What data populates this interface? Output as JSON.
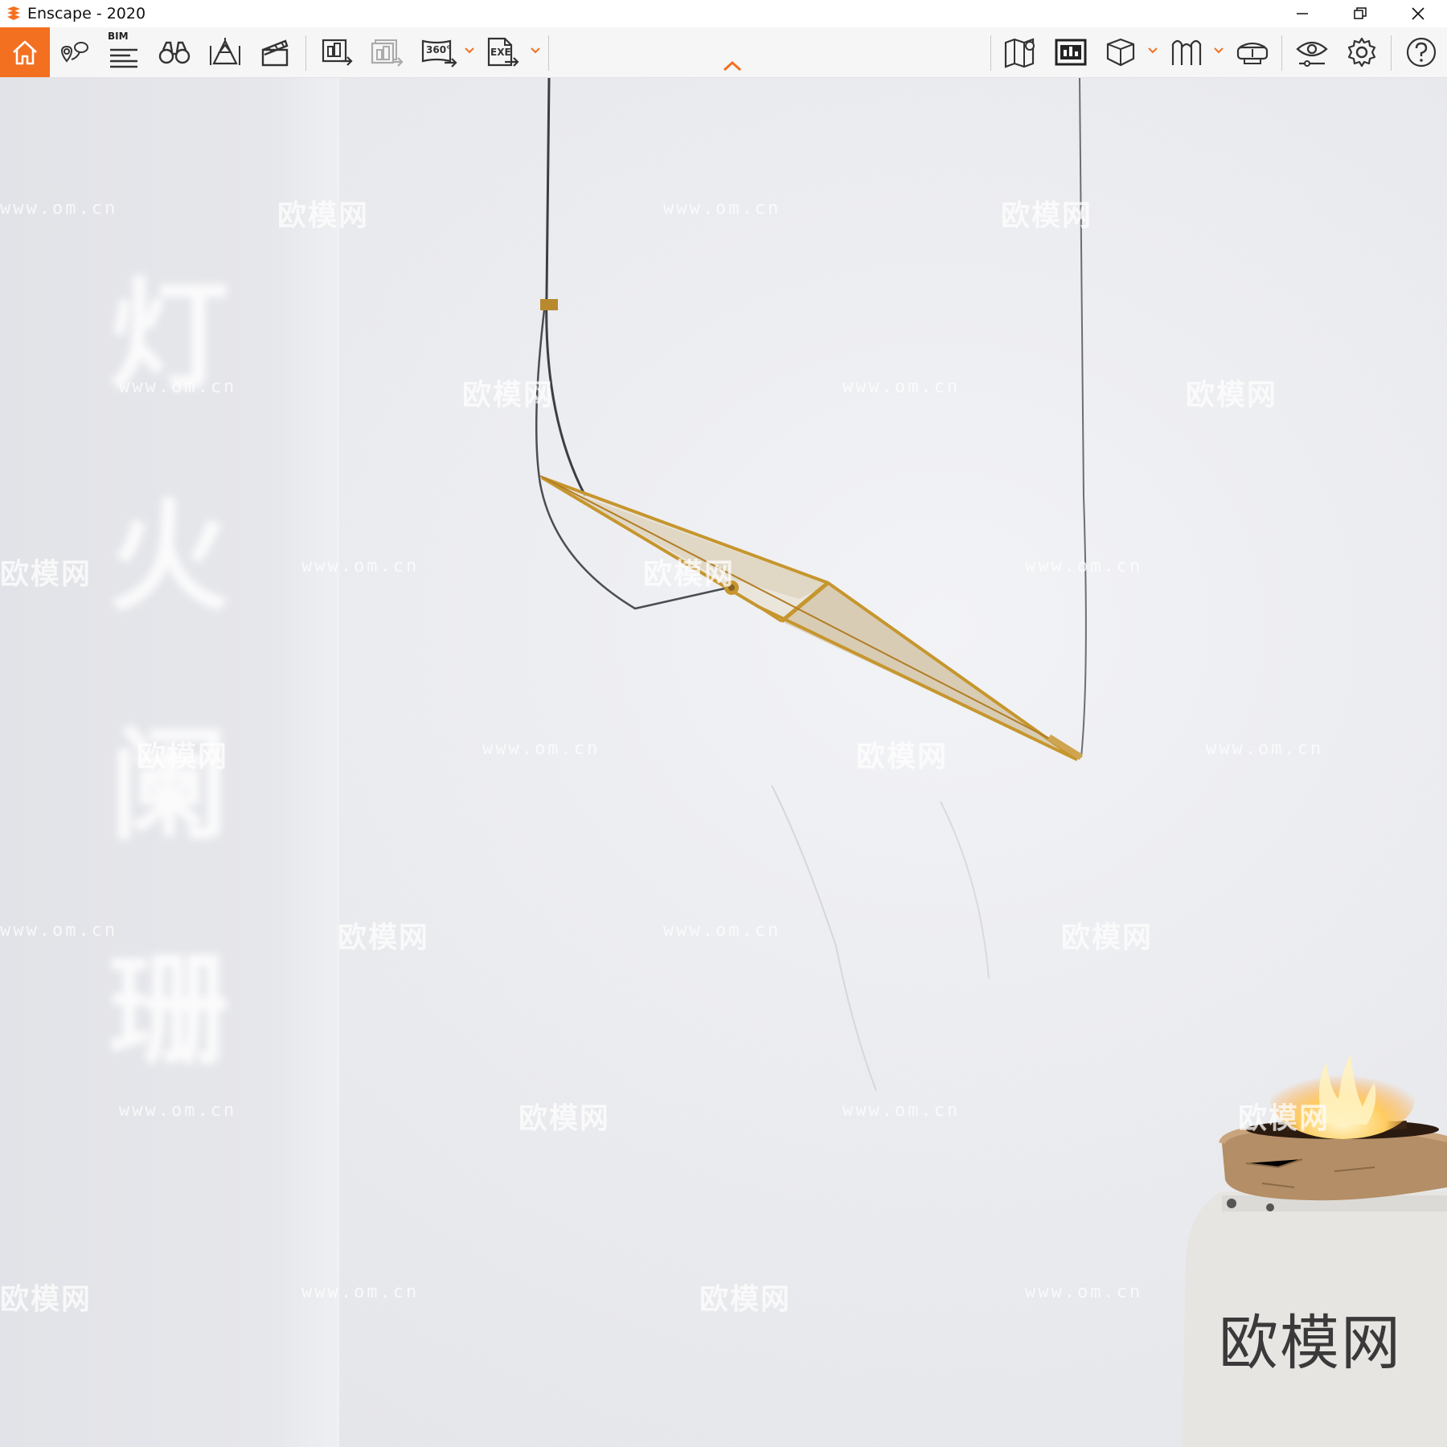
{
  "window": {
    "title": "Enscape - 2020",
    "controls": [
      "minimize",
      "restore",
      "close"
    ]
  },
  "toolbar": {
    "accent_color": "#f37021",
    "bim_label": "BIM",
    "icons": {
      "home": "home-icon",
      "location": "location-pin-icon",
      "bim": "bim-list-icon",
      "binoculars": "binoculars-icon",
      "light": "light-cone-icon",
      "clapper": "clapperboard-icon",
      "screenshot": "render-export-icon",
      "batch": "batch-render-icon",
      "panorama": "panorama-360-icon",
      "exe": "exe-export-icon",
      "map": "map-icon",
      "asset": "asset-library-icon",
      "cube": "cube-view-icon",
      "ortho": "ortho-view-icon",
      "vr": "vr-headset-icon",
      "visual": "visual-settings-icon",
      "settings": "gear-icon",
      "help": "help-icon"
    },
    "panorama_label": "360°",
    "exe_label": "EXE"
  },
  "viewport": {
    "left_panel_chars": [
      "灯",
      "火",
      "阑",
      "珊"
    ],
    "watermark_text": "欧模网",
    "watermark_url": "www.om.cn",
    "corner_logo": "欧模网"
  }
}
